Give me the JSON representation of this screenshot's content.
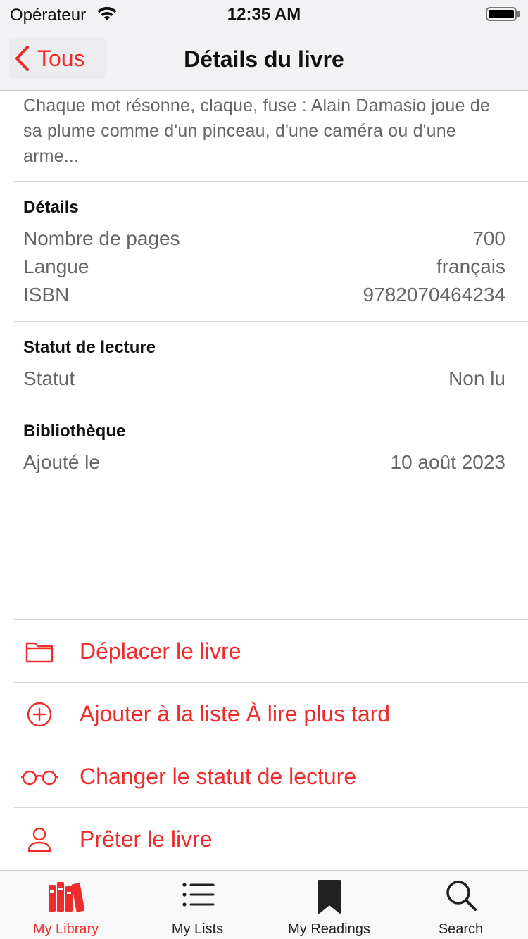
{
  "status_bar": {
    "carrier": "Opérateur",
    "time": "12:35 AM"
  },
  "nav": {
    "back_label": "Tous",
    "title": "Détails du livre"
  },
  "description": "Chaque mot résonne, claque, fuse : Alain Damasio joue de sa plume comme d'un pinceau, d'une caméra ou d'une arme...",
  "details": {
    "title": "Détails",
    "rows": [
      {
        "label": "Nombre de pages",
        "value": "700"
      },
      {
        "label": "Langue",
        "value": "français"
      },
      {
        "label": "ISBN",
        "value": "9782070464234"
      }
    ]
  },
  "reading_status": {
    "title": "Statut de lecture",
    "rows": [
      {
        "label": "Statut",
        "value": "Non lu"
      }
    ]
  },
  "library": {
    "title": "Bibliothèque",
    "rows": [
      {
        "label": "Ajouté le",
        "value": "10 août 2023"
      }
    ]
  },
  "actions": [
    {
      "label": "Déplacer le livre",
      "icon": "folder-icon"
    },
    {
      "label": "Ajouter à la liste À lire plus tard",
      "icon": "plus-circle-icon"
    },
    {
      "label": "Changer le statut de lecture",
      "icon": "glasses-icon"
    },
    {
      "label": "Prêter le livre",
      "icon": "person-icon"
    }
  ],
  "tabs": [
    {
      "label": "My Library",
      "icon": "books-icon",
      "active": true
    },
    {
      "label": "My Lists",
      "icon": "list-icon",
      "active": false
    },
    {
      "label": "My Readings",
      "icon": "bookmark-icon",
      "active": false
    },
    {
      "label": "Search",
      "icon": "search-icon",
      "active": false
    }
  ],
  "colors": {
    "accent": "#ef2b2b",
    "secondary_text": "#666666",
    "bar_background": "#f2f2f4"
  }
}
